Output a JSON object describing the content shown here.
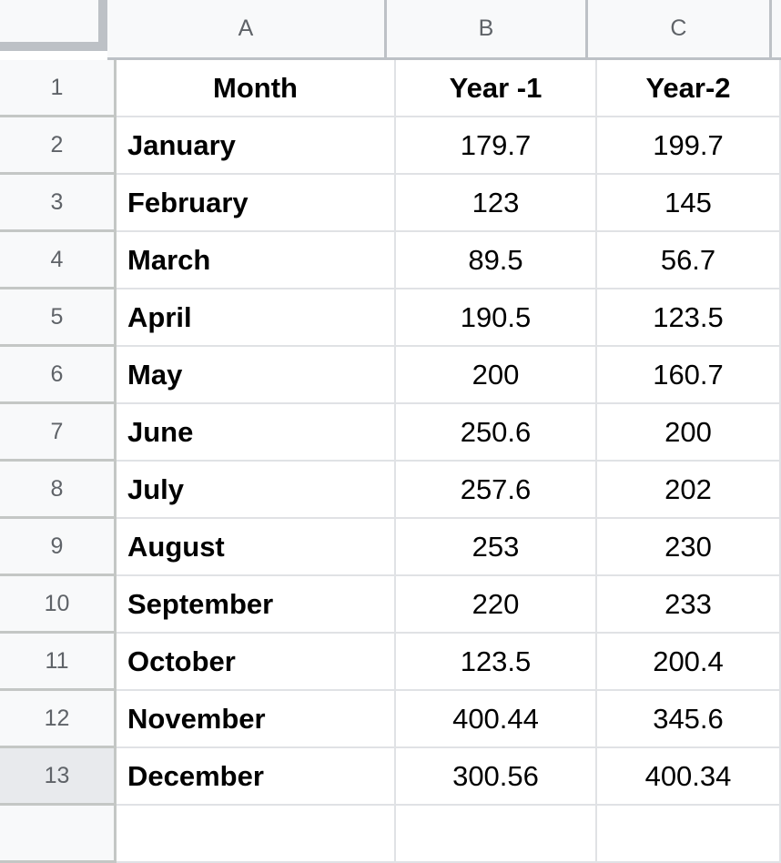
{
  "app": {
    "type": "spreadsheet"
  },
  "colors": {
    "header_bg": "#f8f9fa",
    "header_text": "#5f6368",
    "gridline": "#e0e2e5",
    "row_header_border": "#c4c7c5",
    "active_row_bg": "#e8eaed",
    "cell_text": "#000000",
    "cell_bg": "#ffffff"
  },
  "column_headers": [
    {
      "label": "A"
    },
    {
      "label": "B"
    },
    {
      "label": "C"
    }
  ],
  "row_headers": [
    "1",
    "2",
    "3",
    "4",
    "5",
    "6",
    "7",
    "8",
    "9",
    "10",
    "11",
    "12",
    "13"
  ],
  "active_row": "13",
  "table": {
    "header": {
      "a": "Month",
      "b": "Year -1",
      "c": "Year-2"
    },
    "rows": [
      {
        "row": "2",
        "a": "January",
        "b": "179.7",
        "c": "199.7"
      },
      {
        "row": "3",
        "a": "February",
        "b": "123",
        "c": "145"
      },
      {
        "row": "4",
        "a": "March",
        "b": "89.5",
        "c": "56.7"
      },
      {
        "row": "5",
        "a": "April",
        "b": "190.5",
        "c": "123.5"
      },
      {
        "row": "6",
        "a": "May",
        "b": "200",
        "c": "160.7"
      },
      {
        "row": "7",
        "a": "June",
        "b": "250.6",
        "c": "200"
      },
      {
        "row": "8",
        "a": "July",
        "b": "257.6",
        "c": "202"
      },
      {
        "row": "9",
        "a": "August",
        "b": "253",
        "c": "230"
      },
      {
        "row": "10",
        "a": "September",
        "b": "220",
        "c": "233"
      },
      {
        "row": "11",
        "a": "October",
        "b": "123.5",
        "c": "200.4"
      },
      {
        "row": "12",
        "a": "November",
        "b": "400.44",
        "c": "345.6"
      },
      {
        "row": "13",
        "a": "December",
        "b": "300.56",
        "c": "400.34"
      }
    ]
  },
  "chart_data": {
    "type": "table",
    "title": "",
    "columns": [
      "Month",
      "Year -1",
      "Year-2"
    ],
    "categories": [
      "January",
      "February",
      "March",
      "April",
      "May",
      "June",
      "July",
      "August",
      "September",
      "October",
      "November",
      "December"
    ],
    "series": [
      {
        "name": "Year -1",
        "values": [
          179.7,
          123,
          89.5,
          190.5,
          200,
          250.6,
          257.6,
          253,
          220,
          123.5,
          400.44,
          300.56
        ]
      },
      {
        "name": "Year-2",
        "values": [
          199.7,
          145,
          56.7,
          123.5,
          160.7,
          200,
          202,
          230,
          233,
          200.4,
          345.6,
          400.34
        ]
      }
    ]
  }
}
